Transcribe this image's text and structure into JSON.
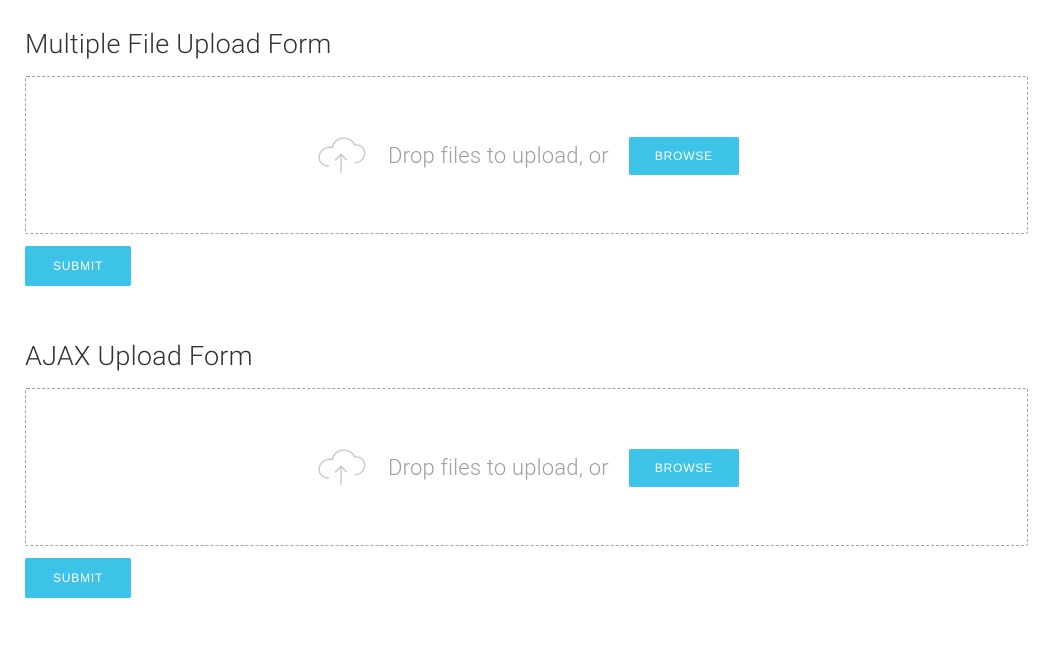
{
  "forms": [
    {
      "title": "Multiple File Upload Form",
      "drop_text": "Drop files to upload, or",
      "browse_label": "BROWSE",
      "submit_label": "SUBMIT"
    },
    {
      "title": "AJAX Upload Form",
      "drop_text": "Drop files to upload, or",
      "browse_label": "BROWSE",
      "submit_label": "SUBMIT"
    }
  ]
}
